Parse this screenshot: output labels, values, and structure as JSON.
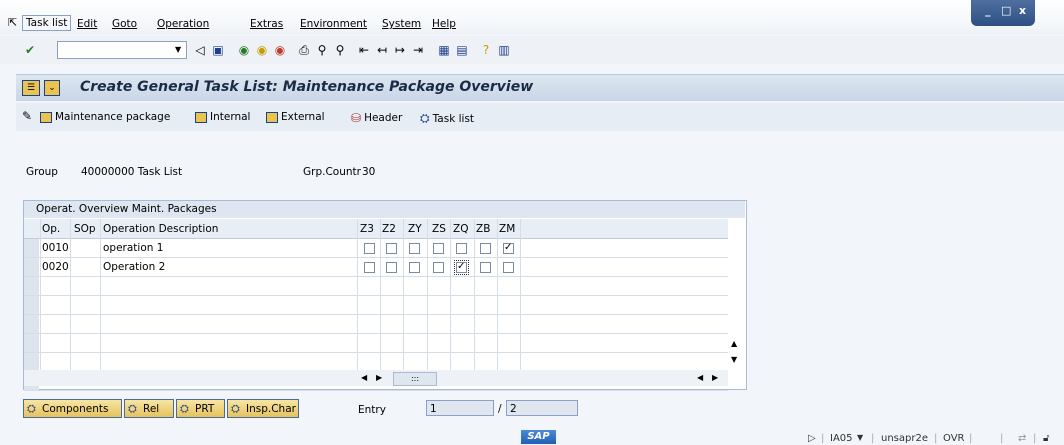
{
  "menu": [
    "Task list",
    "Edit",
    "Goto",
    "Operation",
    "Extras",
    "Environment",
    "System",
    "Help"
  ],
  "window_controls": [
    "_",
    "□",
    "x"
  ],
  "title": "Create General Task List: Maintenance Package Overview",
  "app_toolbar": {
    "maintenance_package": "Maintenance package",
    "internal": "Internal",
    "external": "External",
    "header": "Header",
    "task_list": "Task list"
  },
  "header_fields": {
    "group_label": "Group",
    "group_value": "40000000 Task List",
    "grp_countr_label": "Grp.Countr",
    "grp_countr_value": "30"
  },
  "table": {
    "title": "Operat. Overview Maint. Packages",
    "columns": [
      "Op.",
      "SOp",
      "Operation Description",
      "Z3",
      "Z2",
      "ZY",
      "ZS",
      "ZQ",
      "ZB",
      "ZM"
    ],
    "rows": [
      {
        "op": "0010",
        "sop": "",
        "desc": "operation 1",
        "checks": [
          false,
          false,
          false,
          false,
          false,
          false,
          true
        ]
      },
      {
        "op": "0020",
        "sop": "",
        "desc": "Operation 2",
        "checks": [
          false,
          false,
          false,
          false,
          true,
          false,
          false
        ]
      }
    ],
    "hscroll_thumb": ":::"
  },
  "bottom_buttons": {
    "components": "Components",
    "rel": "Rel",
    "prt": "PRT",
    "insp_char": "Insp.Char"
  },
  "entry": {
    "label": "Entry",
    "current": "1",
    "separator": "/",
    "total": "2"
  },
  "status": {
    "logo": "SAP",
    "transaction": "IA05",
    "server": "unsapr2e",
    "mode": "OVR"
  }
}
